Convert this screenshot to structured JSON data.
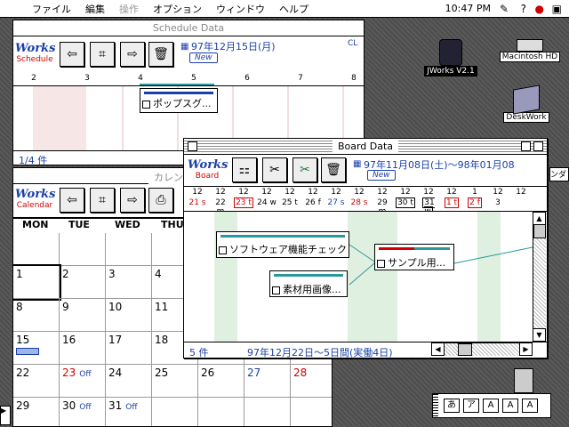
{
  "menubar": {
    "items": [
      "ファイル",
      "編集",
      "操作",
      "オプション",
      "ウィンドウ",
      "ヘルプ"
    ],
    "dimmed_index": 2,
    "clock": "10:47 PM"
  },
  "schedule": {
    "title": "Schedule Data",
    "logo_word": "Works",
    "logo_sub": "Schedule",
    "date_label": "97年12月15日(月)",
    "corner_label": "CL",
    "new_tag": "New",
    "ruler": [
      "2",
      "3",
      "4",
      "5",
      "6",
      "7",
      "8"
    ],
    "task_label": "ポップスグ...",
    "status": "1/4 件"
  },
  "calendar": {
    "title": "カレンダ",
    "logo_word": "Works",
    "logo_sub": "Calendar",
    "days": [
      "MON",
      "TUE",
      "WED",
      "THU",
      "",
      "",
      ""
    ],
    "rows": [
      [
        {
          "d": ""
        },
        {
          "d": ""
        },
        {
          "d": ""
        },
        {
          "d": ""
        },
        {
          "d": ""
        },
        {
          "d": ""
        },
        {
          "d": ""
        }
      ],
      [
        {
          "d": "1"
        },
        {
          "d": "2"
        },
        {
          "d": "3"
        },
        {
          "d": "4"
        },
        {
          "d": ""
        },
        {
          "d": ""
        },
        {
          "d": ""
        }
      ],
      [
        {
          "d": "8"
        },
        {
          "d": "9"
        },
        {
          "d": "10"
        },
        {
          "d": "11"
        },
        {
          "d": ""
        },
        {
          "d": ""
        },
        {
          "d": ""
        }
      ],
      [
        {
          "d": "15"
        },
        {
          "d": "16"
        },
        {
          "d": "17"
        },
        {
          "d": "18"
        },
        {
          "d": ""
        },
        {
          "d": ""
        },
        {
          "d": ""
        }
      ],
      [
        {
          "d": "22"
        },
        {
          "d": "23",
          "note": "Off"
        },
        {
          "d": "24"
        },
        {
          "d": "25"
        },
        {
          "d": "26"
        },
        {
          "d": "27"
        },
        {
          "d": "28"
        }
      ],
      [
        {
          "d": "29"
        },
        {
          "d": "30",
          "note": "Off"
        },
        {
          "d": "31",
          "note": "Off"
        },
        {
          "d": ""
        },
        {
          "d": ""
        },
        {
          "d": ""
        },
        {
          "d": ""
        }
      ]
    ]
  },
  "board": {
    "title": "Board Data",
    "logo_word": "Works",
    "logo_sub": "Board",
    "date_range": "97年11月08日(土)～98年01月08",
    "new_tag": "New",
    "ruler_top": [
      "12",
      "12",
      "12",
      "12",
      "12",
      "12",
      "12",
      "12",
      "12",
      "12",
      "12",
      "12",
      "1",
      "12",
      "12"
    ],
    "ruler_bottom": [
      "21 s",
      "22 m",
      "23 t",
      "24 w",
      "25 t",
      "26 f",
      "27 s",
      "28 s",
      "29 m",
      "30 t",
      "31 w",
      "1 t",
      "2 f",
      "3"
    ],
    "tasks": [
      "ソフトウェア機能チェック",
      "サンプル用...",
      "素材用画像..."
    ],
    "status_count": "5 件",
    "status_range": "97年12月22日～5日間(実働4日)"
  },
  "desktop": {
    "app_label": "JWorks V2.1",
    "hd_label": "Macintosh HD",
    "folder_label": "DeskWork",
    "right_edge_label": "ンダ"
  },
  "ime": {
    "keys": [
      "あ",
      "ア",
      "A",
      "A",
      "A"
    ]
  }
}
